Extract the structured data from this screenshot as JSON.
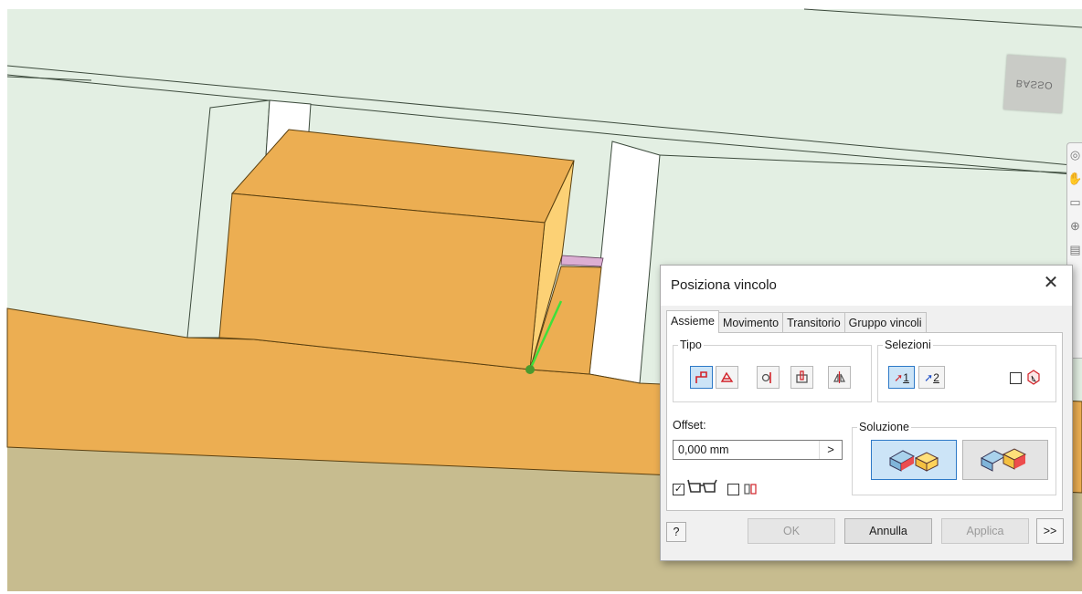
{
  "viewport": {
    "viewcube_label": "BASSO"
  },
  "dialog": {
    "title": "Posiziona vincolo",
    "close_glyph": "✕",
    "tabs": [
      "Assieme",
      "Movimento",
      "Transitorio",
      "Gruppo vincoli"
    ],
    "active_tab": "Assieme",
    "tipo": {
      "legend": "Tipo",
      "buttons": [
        "mate-icon",
        "angle-icon",
        "tangent-icon",
        "insert-icon",
        "symmetry-icon"
      ],
      "selected": "mate-icon"
    },
    "selezioni": {
      "legend": "Selezioni",
      "first_label": "1",
      "second_label": "2",
      "pick_part_first_checked": false
    },
    "offset": {
      "label": "Offset:",
      "value": "0,000 mm",
      "arrow": ">"
    },
    "show_preview_checked": true,
    "predict_offset_checked": false,
    "soluzione": {
      "legend": "Soluzione",
      "selected": "mate"
    },
    "buttons": {
      "ok": "OK",
      "cancel": "Annulla",
      "apply": "Applica",
      "more": ">>",
      "help": "?"
    }
  },
  "colors": {
    "part_orange": "#ecae52",
    "part_light": "#fcd175",
    "background_plane": "#e3efe3",
    "floor": "#c7bc8f",
    "accent_blue": "#2d79c7"
  }
}
